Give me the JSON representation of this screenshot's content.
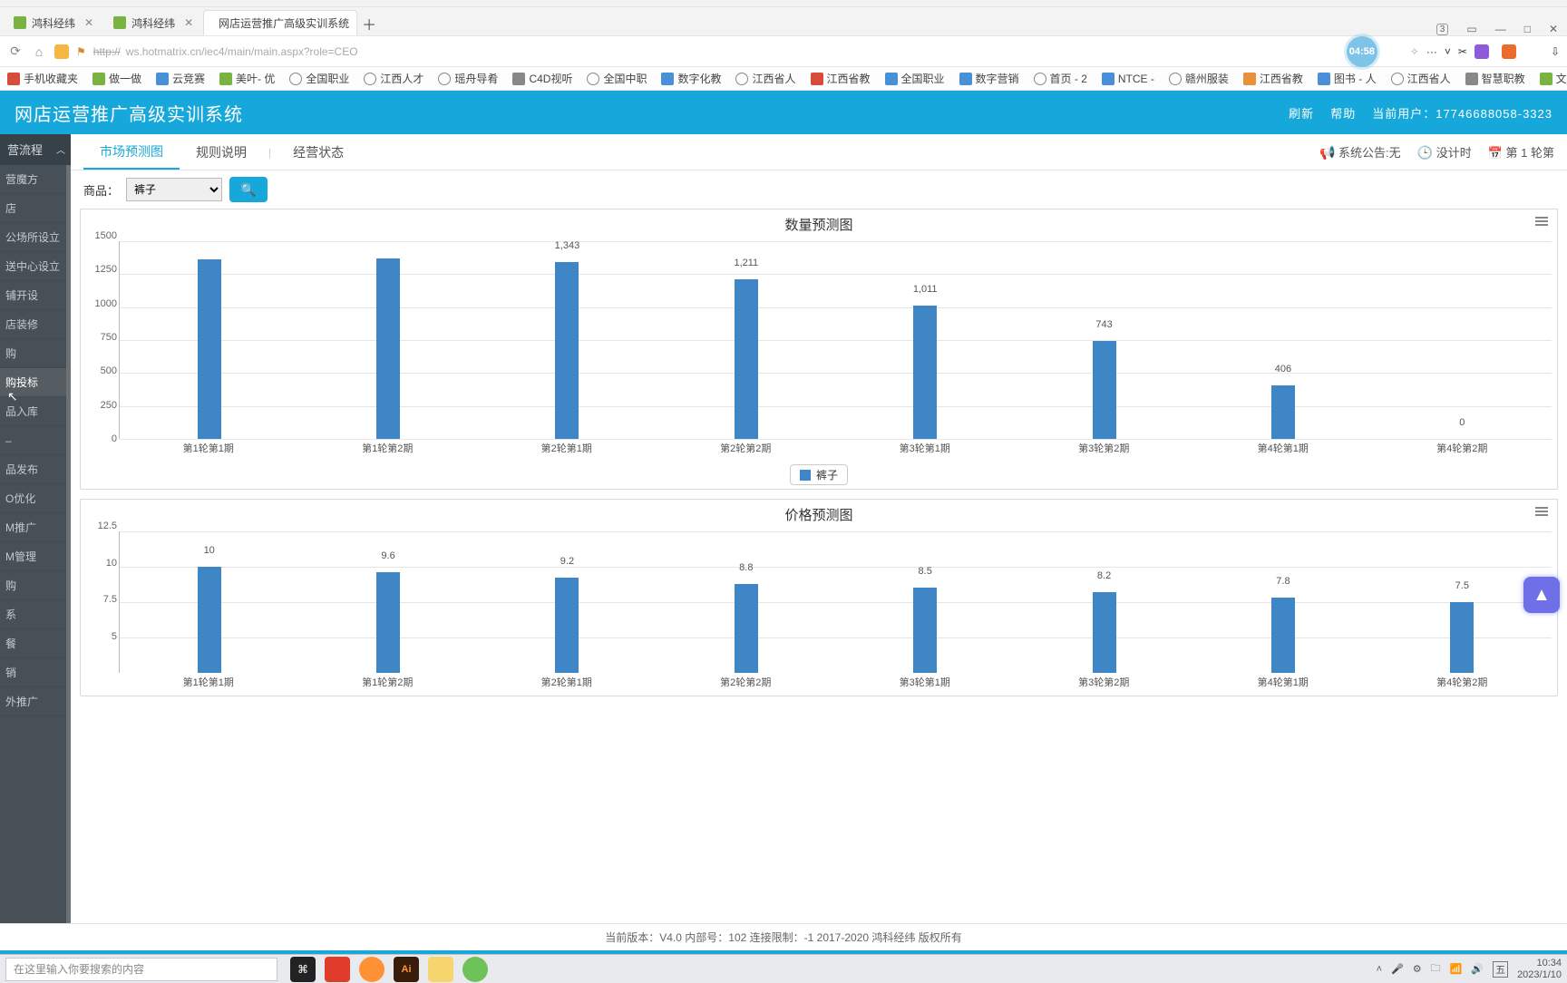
{
  "window": {
    "pin_badge": "3",
    "controls": {
      "min": "—",
      "max": "□",
      "close": "✕"
    }
  },
  "tabs": {
    "items": [
      {
        "label": "鸿科经纬",
        "favicon_color": "#7bb342"
      },
      {
        "label": "鸿科经纬",
        "favicon_color": "#7bb342"
      },
      {
        "label": "网店运营推广高级实训系统",
        "favicon_color": "#888"
      }
    ],
    "active_index": 2,
    "plus": "＋"
  },
  "addr": {
    "reload": "⟳",
    "home": "⌂",
    "proto": "http://",
    "url_rest": "ws.hotmatrix.cn/iec4/main/main.aspx?role=CEO",
    "timer": "04:58",
    "more": "···",
    "chev": "˅",
    "cut": "✂",
    "dl": "⇩"
  },
  "bookmarks": [
    {
      "label": "手机收藏夹",
      "cls": "bm-red"
    },
    {
      "label": "做一做",
      "cls": "bm-green"
    },
    {
      "label": "云竞赛",
      "cls": "bm-blue"
    },
    {
      "label": "美叶- 优",
      "cls": "bm-green"
    },
    {
      "label": "全国职业",
      "cls": "bm-globe"
    },
    {
      "label": "江西人才",
      "cls": "bm-globe"
    },
    {
      "label": "瑶舟导肴",
      "cls": "bm-globe"
    },
    {
      "label": "C4D视听",
      "cls": "bm-gray"
    },
    {
      "label": "全国中职",
      "cls": "bm-globe"
    },
    {
      "label": "数字化教",
      "cls": "bm-blue"
    },
    {
      "label": "江西省人",
      "cls": "bm-globe"
    },
    {
      "label": "江西省教",
      "cls": "bm-red"
    },
    {
      "label": "全国职业",
      "cls": "bm-blue"
    },
    {
      "label": "数字营销",
      "cls": "bm-blue"
    },
    {
      "label": "首页 - 2",
      "cls": "bm-globe"
    },
    {
      "label": "NTCE -",
      "cls": "bm-blue"
    },
    {
      "label": "赣州服装",
      "cls": "bm-globe"
    },
    {
      "label": "江西省教",
      "cls": "bm-orange"
    },
    {
      "label": "图书 - 人",
      "cls": "bm-blue"
    },
    {
      "label": "江西省人",
      "cls": "bm-globe"
    },
    {
      "label": "智慧职教",
      "cls": "bm-gray"
    },
    {
      "label": "文旅课堂",
      "cls": "bm-green"
    }
  ],
  "header": {
    "title": "网店运营推广高级实训系统",
    "refresh": "刷新",
    "help": "帮助",
    "user_label": "当前用户：",
    "user_value": "17746688058-3323"
  },
  "sidebar": {
    "head": "营流程",
    "chev": "︿",
    "items": [
      "营魔方",
      "店",
      "公场所设立",
      "送中心设立",
      "铺开设",
      "店装修",
      "购",
      "购投标",
      "品入库",
      "–",
      "品发布",
      "O优化",
      "M推广",
      "M管理",
      "购",
      "系",
      "餐",
      "销",
      "外推广"
    ],
    "hover_index": 7
  },
  "content_tabs": {
    "items": [
      "市场预测图",
      "规则说明",
      "|",
      "经营状态"
    ],
    "active_index": 0
  },
  "right_info": {
    "announce_label": "系统公告:无",
    "timer_label": "没计时",
    "round_label": "第 1 轮第"
  },
  "filter": {
    "label": "商品：",
    "value": "裤子",
    "search_icon": "🔍"
  },
  "chart_data": [
    {
      "type": "bar",
      "title": "数量预测图",
      "categories": [
        "第1轮第1期",
        "第1轮第2期",
        "第2轮第1期",
        "第2轮第2期",
        "第3轮第1期",
        "第3轮第2期",
        "第4轮第1期",
        "第4轮第2期"
      ],
      "series": [
        {
          "name": "裤子",
          "values": [
            1360,
            1370,
            1343,
            1211,
            1011,
            743,
            406,
            0
          ]
        }
      ],
      "display_labels": [
        "",
        "",
        "1,343",
        "1,211",
        "1,011",
        "743",
        "406",
        "0"
      ],
      "ylim": [
        0,
        1500
      ],
      "yticks": [
        0,
        250,
        500,
        750,
        1000,
        1250,
        1500
      ],
      "legend": "裤子"
    },
    {
      "type": "bar",
      "title": "价格预测图",
      "categories": [
        "第1轮第1期",
        "第1轮第2期",
        "第2轮第1期",
        "第2轮第2期",
        "第3轮第1期",
        "第3轮第2期",
        "第4轮第1期",
        "第4轮第2期"
      ],
      "series": [
        {
          "name": "裤子",
          "values": [
            10,
            9.6,
            9.2,
            8.8,
            8.5,
            8.2,
            7.8,
            7.5
          ]
        }
      ],
      "display_labels": [
        "10",
        "9.6",
        "9.2",
        "8.8",
        "8.5",
        "8.2",
        "7.8",
        "7.5"
      ],
      "ylim": [
        2.5,
        12.5
      ],
      "yticks": [
        5,
        7.5,
        10,
        12.5
      ],
      "legend": "裤子"
    }
  ],
  "footer": "当前版本：V4.0 内部号：102 连接限制：-1 2017-2020 鸿科经纬 版权所有",
  "taskbar": {
    "search_placeholder": "在这里输入你要搜索的内容",
    "time": "10:34",
    "date": "2023/1/10"
  }
}
